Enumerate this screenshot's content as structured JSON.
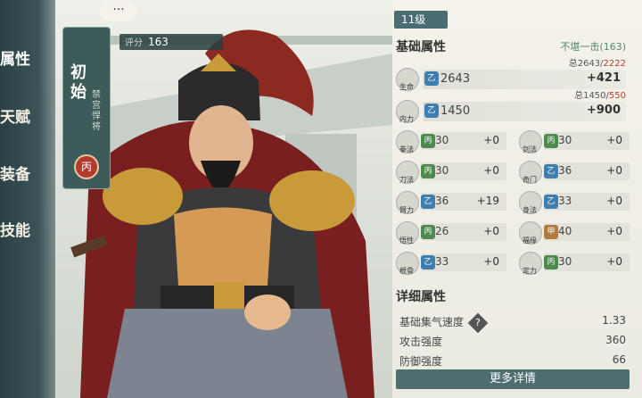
{
  "left_tabs": [
    "属性",
    "天赋",
    "装备",
    "技能"
  ],
  "hero": {
    "name": "初始",
    "title": "禁宫悍将",
    "grade": "丙",
    "score_label": "评分",
    "score": "163",
    "chat_icon": "···"
  },
  "panel": {
    "level": "11级",
    "basic_title": "基础属性",
    "tower_text": "不堪一击(163)",
    "hp": {
      "name": "生命",
      "tier": "乙",
      "value": "2643",
      "total_prefix": "总2643/",
      "total_max": "2222",
      "bonus": "+421"
    },
    "internal": {
      "name": "内力",
      "tier": "乙",
      "value": "1450",
      "total_prefix": "总1450/",
      "total_max": "550",
      "bonus": "+900"
    },
    "attrs": [
      {
        "name": "拳法",
        "tier": "丙",
        "value": "30",
        "add": "+0"
      },
      {
        "name": "剑法",
        "tier": "丙",
        "value": "30",
        "add": "+0"
      },
      {
        "name": "刀法",
        "tier": "丙",
        "value": "30",
        "add": "+0"
      },
      {
        "name": "奇门",
        "tier": "乙",
        "value": "36",
        "add": "+0"
      },
      {
        "name": "臂力",
        "tier": "乙",
        "value": "36",
        "add": "+19"
      },
      {
        "name": "身法",
        "tier": "乙",
        "value": "33",
        "add": "+0"
      },
      {
        "name": "悟性",
        "tier": "丙",
        "value": "26",
        "add": "+0"
      },
      {
        "name": "福缘",
        "tier": "甲",
        "value": "40",
        "add": "+0"
      },
      {
        "name": "根骨",
        "tier": "乙",
        "value": "33",
        "add": "+0"
      },
      {
        "name": "定力",
        "tier": "丙",
        "value": "30",
        "add": "+0"
      }
    ],
    "detail_title": "详细属性",
    "details": [
      {
        "label": "基础集气速度",
        "value": "1.33"
      },
      {
        "label": "攻击强度",
        "value": "360"
      },
      {
        "label": "防御强度",
        "value": "66"
      }
    ],
    "help_icon": "?",
    "more_button": "更多详情"
  },
  "colors": {
    "panel_bg": "#f4f2ea",
    "accent": "#4d6d70",
    "tier_yi": "#3f7fb0",
    "tier_bing": "#4d8a4e",
    "tier_jia": "#b27a3c",
    "max_red": "#c0392b"
  }
}
